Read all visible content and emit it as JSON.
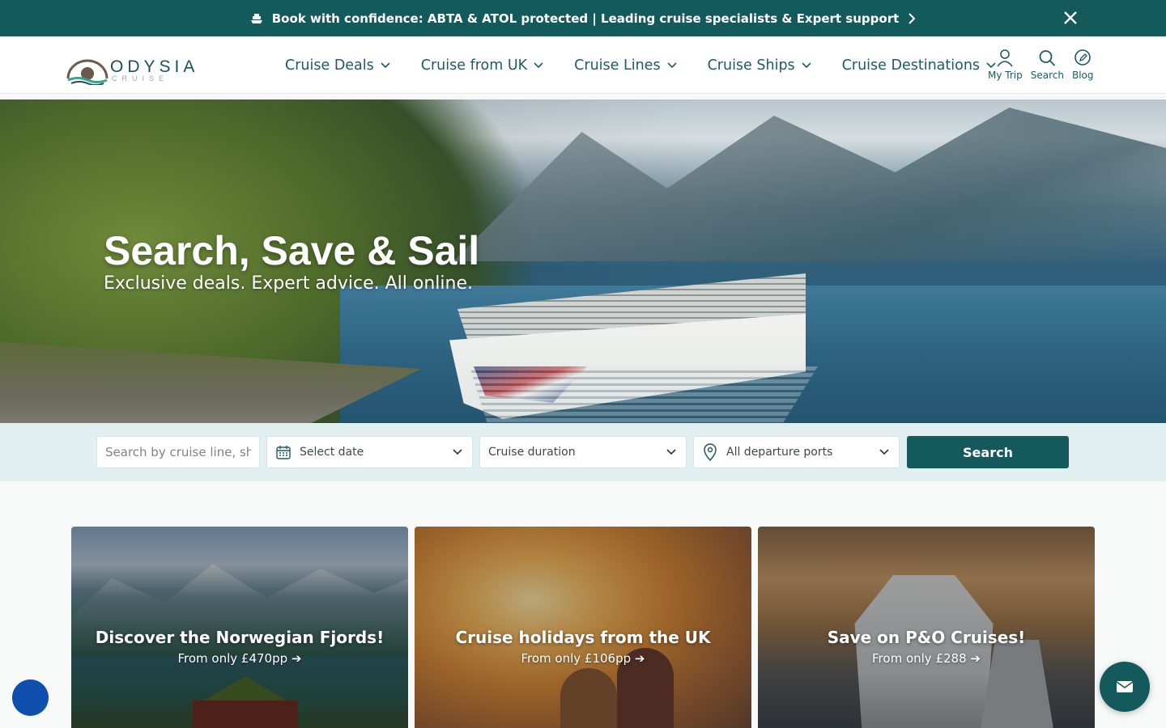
{
  "banner": {
    "text": "Book with confidence: ABTA & ATOL protected | Leading cruise specialists & Expert support"
  },
  "logo": {
    "word": "ODYSIA",
    "sub": "CRUISE"
  },
  "nav": {
    "items": [
      {
        "label": "Cruise Deals"
      },
      {
        "label": "Cruise from UK"
      },
      {
        "label": "Cruise Lines"
      },
      {
        "label": "Cruise Ships"
      },
      {
        "label": "Cruise Destinations"
      }
    ]
  },
  "tools": {
    "my_trip": "My Trip",
    "search": "Search",
    "blog": "Blog"
  },
  "hero": {
    "title": "Search, Save & Sail",
    "tagline": "Exclusive deals. Expert advice. All online."
  },
  "search_form": {
    "keyword_placeholder": "Search by cruise line, ship",
    "date_label": "Select date",
    "duration_label": "Cruise duration",
    "ports_label": "All departure ports",
    "button": "Search"
  },
  "cards": [
    {
      "title": "Discover the Norwegian Fjords!",
      "subtitle": "From only £470pp ➔"
    },
    {
      "title": "Cruise holidays from the UK",
      "subtitle": "From only £106pp ➔"
    },
    {
      "title": "Save on P&O Cruises!",
      "subtitle": "From only £288 ➔"
    }
  ],
  "colors": {
    "brand": "#14595c",
    "nav_text": "#1c5a66",
    "search_strip": "#e1eff0"
  }
}
